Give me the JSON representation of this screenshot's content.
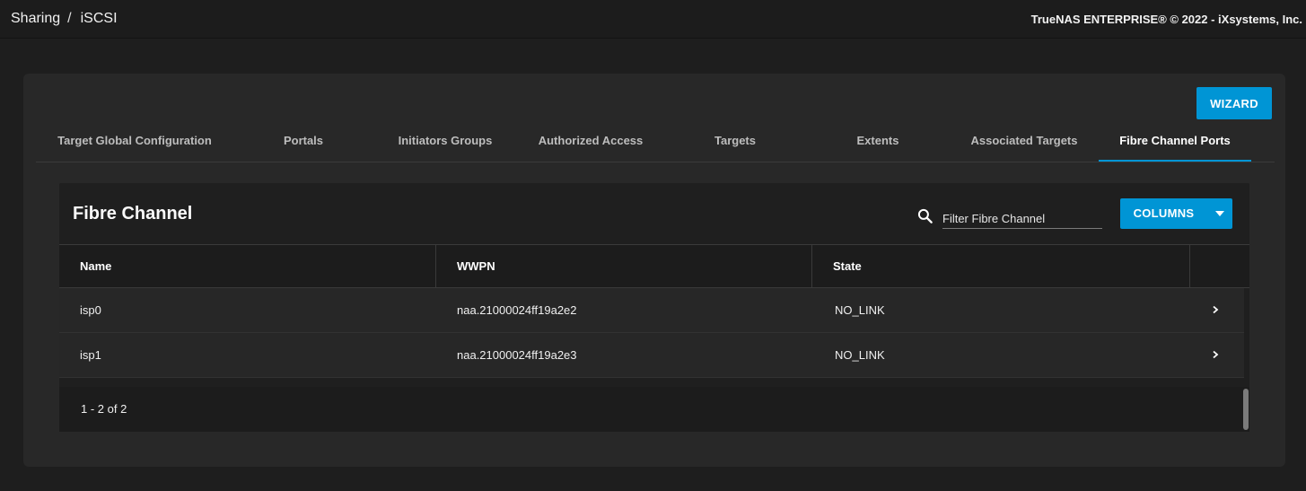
{
  "header": {
    "breadcrumb": [
      "Sharing",
      "iSCSI"
    ],
    "separator": "/",
    "copyright": "TrueNAS ENTERPRISE® © 2022 - iXsystems, Inc."
  },
  "card": {
    "wizard_label": "WIZARD",
    "tabs": [
      {
        "label": "Target Global Configuration",
        "active": false
      },
      {
        "label": "Portals",
        "active": false
      },
      {
        "label": "Initiators Groups",
        "active": false
      },
      {
        "label": "Authorized Access",
        "active": false
      },
      {
        "label": "Targets",
        "active": false
      },
      {
        "label": "Extents",
        "active": false
      },
      {
        "label": "Associated Targets",
        "active": false
      },
      {
        "label": "Fibre Channel Ports",
        "active": true
      }
    ]
  },
  "table": {
    "title": "Fibre Channel",
    "filter_placeholder": "Filter Fibre Channel",
    "filter_value": "",
    "columns_label": "COLUMNS",
    "headers": [
      "Name",
      "WWPN",
      "State"
    ],
    "rows": [
      {
        "name": "isp0",
        "wwpn": "naa.21000024ff19a2e2",
        "state": "NO_LINK"
      },
      {
        "name": "isp1",
        "wwpn": "naa.21000024ff19a2e3",
        "state": "NO_LINK"
      }
    ],
    "pagination": "1 - 2 of 2"
  },
  "icons": {
    "search": "search-icon",
    "caret": "caret-down-icon",
    "row_expand": "chevron-right-icon"
  },
  "colors": {
    "accent": "#0095d5",
    "background": "#1e1e1e",
    "card": "#282828"
  }
}
